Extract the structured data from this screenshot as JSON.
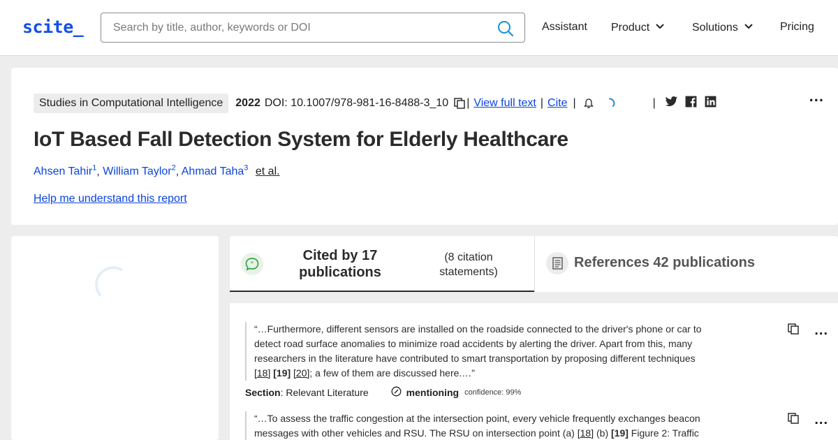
{
  "header": {
    "logo": "scite_",
    "search_placeholder": "Search by title, author, keywords or DOI",
    "nav": {
      "assistant": "Assistant",
      "product": "Product",
      "solutions": "Solutions",
      "pricing": "Pricing"
    }
  },
  "paper": {
    "journal": "Studies in Computational Intelligence",
    "year": "2022",
    "doi": "DOI: 10.1007/978-981-16-8488-3_10",
    "view_full_text": "View full text",
    "cite": "Cite",
    "sep": "|",
    "title": "IoT Based Fall Detection System for Elderly Healthcare",
    "authors": [
      {
        "name": "Ahsen Tahir",
        "sup": "1"
      },
      {
        "name": "William Taylor",
        "sup": "2"
      },
      {
        "name": "Ahmad Taha",
        "sup": "3"
      }
    ],
    "et_al": "et al.",
    "help_link": "Help me understand this report",
    "more": "..."
  },
  "tabs": {
    "cited_by": "Cited by 17 publications",
    "cited_sub": "(8 citation statements)",
    "references": "References 42 publications"
  },
  "citations": [
    {
      "quote_start": "“…Furthermore, different sensors are installed on the roadside connected to the driver's phone or car to detect road surface anomalies to minimize road accidents by alerting the driver. Apart from this, many researchers in the literature have contributed to smart transportation by proposing different techniques ",
      "ref1": "[18]",
      "ref2": "[19]",
      "ref3": "[20]",
      "quote_end": "; a few of them are discussed here.…”",
      "section_key": "Section",
      "section_value": ": Relevant Literature",
      "type": "mentioning",
      "confidence": "confidence: 99%"
    },
    {
      "quote_start": "“…To assess the traffic congestion at the intersection point, every vehicle frequently exchanges beacon messages with other vehicles and RSU. The RSU on intersection point (a) ",
      "ref1": "[18]",
      "mid": " (b) ",
      "ref2": "[19]",
      "quote_end": " Figure 2: Traffic"
    }
  ],
  "colors": {
    "brand": "#1350e8",
    "link": "#0a44e0",
    "cited_icon": "#3aa14a"
  },
  "icons": [
    "search-icon",
    "chevron-down-icon",
    "copy-icon",
    "bell-icon",
    "spinner-icon",
    "twitter-icon",
    "facebook-icon",
    "linkedin-icon",
    "speech-bubble-icon",
    "document-icon",
    "check-circle-icon"
  ]
}
